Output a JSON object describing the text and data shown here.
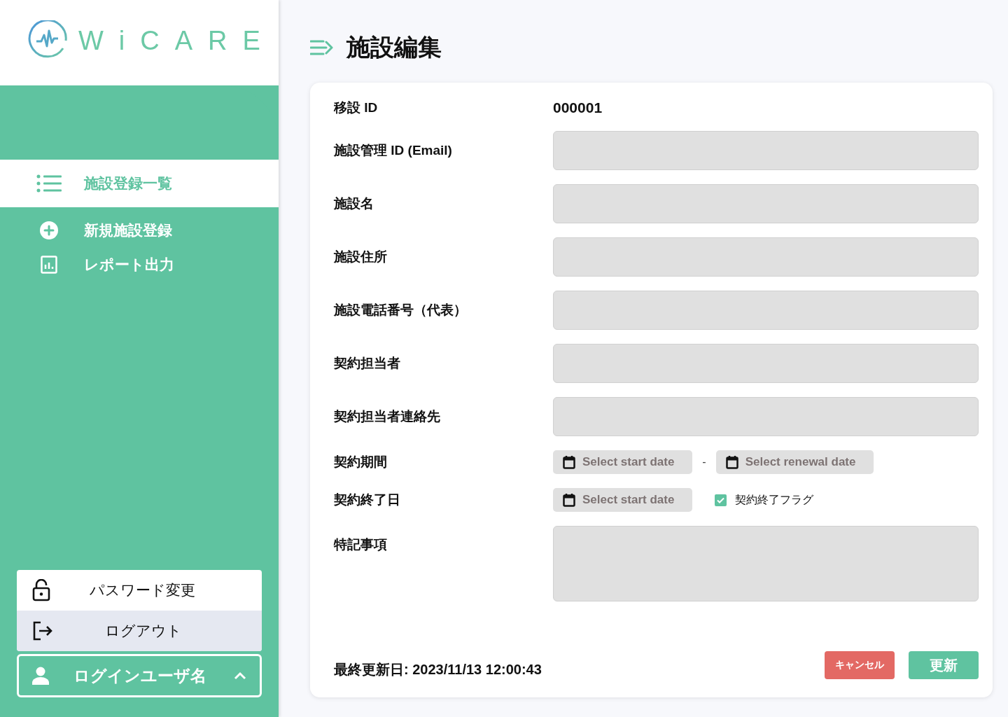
{
  "logo": {
    "text": "WiCARE"
  },
  "sidebar": {
    "items": [
      {
        "label": "施設登録一覧",
        "selected": true
      },
      {
        "label": "新規施設登録",
        "selected": false
      },
      {
        "label": "レポート出力",
        "selected": false
      }
    ],
    "account_menu": [
      {
        "label": "パスワード変更",
        "selected": false
      },
      {
        "label": "ログアウト",
        "selected": true
      }
    ],
    "user": {
      "name": "ログインユーザ名",
      "expanded": true
    }
  },
  "page": {
    "title": "施設編集"
  },
  "form": {
    "rows": [
      {
        "kind": "static",
        "label": "移設 ID",
        "value": "000001"
      },
      {
        "kind": "text",
        "label": "施設管理 ID (Email)"
      },
      {
        "kind": "text",
        "label": "施設名"
      },
      {
        "kind": "text",
        "label": "施設住所"
      },
      {
        "kind": "text",
        "label": "施設電話番号（代表）"
      },
      {
        "kind": "text",
        "label": "契約担当者"
      },
      {
        "kind": "text",
        "label": "契約担当者連絡先"
      },
      {
        "kind": "range",
        "label": "契約期間",
        "placeholder": "Select start date",
        "separator": "-",
        "placeholder_2": "Select renewal date"
      },
      {
        "kind": "date_check",
        "label": "契約終了日",
        "placeholder": "Select start date",
        "check_label": "契約終了フラグ",
        "checked": true
      },
      {
        "kind": "textarea",
        "label": "特記事項"
      }
    ],
    "last_updated": "最終更新日: 2023/11/13 12:00:43",
    "buttons": [
      {
        "label": "キャンセル",
        "kind": "cancel"
      },
      {
        "label": "更新",
        "kind": "primary"
      }
    ]
  }
}
